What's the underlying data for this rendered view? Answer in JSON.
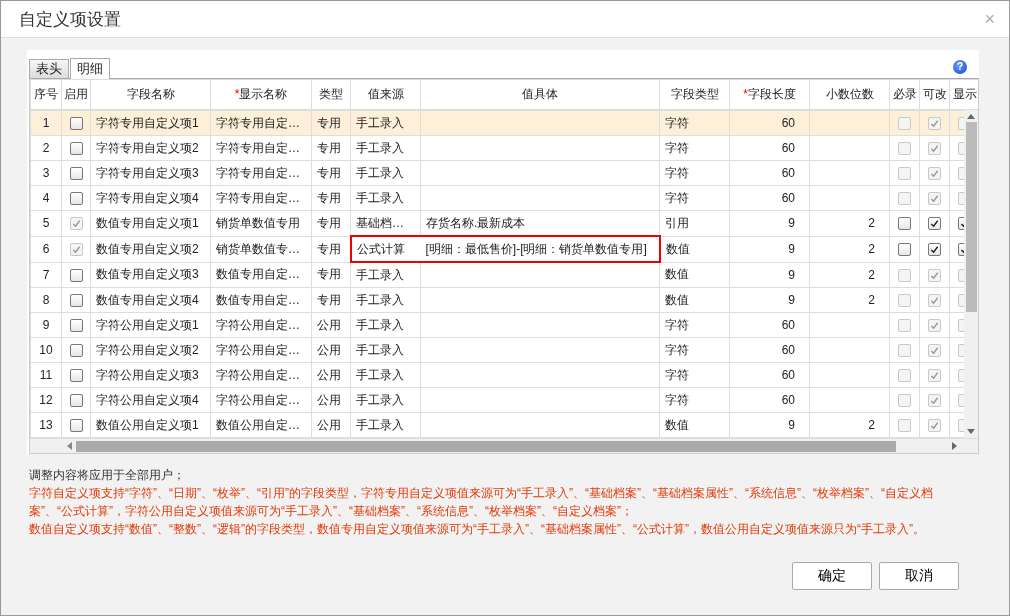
{
  "dialog": {
    "title": "自定义项设置",
    "close": "×"
  },
  "tabs": [
    {
      "label": "表头",
      "selected": false
    },
    {
      "label": "明细",
      "selected": true
    }
  ],
  "help": "?",
  "table": {
    "columns": [
      {
        "label": "序号"
      },
      {
        "label": "启用"
      },
      {
        "label": "字段名称"
      },
      {
        "label": "显示名称",
        "mark": "*"
      },
      {
        "label": "类型"
      },
      {
        "label": "值来源"
      },
      {
        "label": "值具体"
      },
      {
        "label": "字段类型"
      },
      {
        "label": "字段长度",
        "mark": "*"
      },
      {
        "label": "小数位数"
      },
      {
        "label": "必录"
      },
      {
        "label": "可改"
      },
      {
        "label": "显示"
      }
    ],
    "rows": [
      {
        "no": "1",
        "selected": true,
        "highlighted": false,
        "enabled": {
          "checked": false,
          "disabled": false
        },
        "name": "字符专用自定义项1",
        "display": "字符专用自定…",
        "scope": "专用",
        "source": "手工录入",
        "field_type": "字符",
        "length": "60",
        "required": {
          "checked": false,
          "disabled": true
        },
        "editable": {
          "checked": true,
          "disabled": true
        },
        "shown": {
          "checked": false,
          "disabled": true
        }
      },
      {
        "no": "2",
        "selected": false,
        "highlighted": false,
        "enabled": {
          "checked": false,
          "disabled": false
        },
        "name": "字符专用自定义项2",
        "display": "字符专用自定…",
        "scope": "专用",
        "source": "手工录入",
        "field_type": "字符",
        "length": "60",
        "required": {
          "checked": false,
          "disabled": true
        },
        "editable": {
          "checked": true,
          "disabled": true
        },
        "shown": {
          "checked": false,
          "disabled": true
        }
      },
      {
        "no": "3",
        "selected": false,
        "highlighted": false,
        "enabled": {
          "checked": false,
          "disabled": false
        },
        "name": "字符专用自定义项3",
        "display": "字符专用自定…",
        "scope": "专用",
        "source": "手工录入",
        "field_type": "字符",
        "length": "60",
        "required": {
          "checked": false,
          "disabled": true
        },
        "editable": {
          "checked": true,
          "disabled": true
        },
        "shown": {
          "checked": false,
          "disabled": true
        }
      },
      {
        "no": "4",
        "selected": false,
        "highlighted": false,
        "enabled": {
          "checked": false,
          "disabled": false
        },
        "name": "字符专用自定义项4",
        "display": "字符专用自定…",
        "scope": "专用",
        "source": "手工录入",
        "field_type": "字符",
        "length": "60",
        "required": {
          "checked": false,
          "disabled": true
        },
        "editable": {
          "checked": true,
          "disabled": true
        },
        "shown": {
          "checked": false,
          "disabled": true
        }
      },
      {
        "no": "5",
        "selected": false,
        "highlighted": false,
        "enabled": {
          "checked": true,
          "disabled": true
        },
        "name": "数值专用自定义项1",
        "display": "销货单数值专用",
        "scope": "专用",
        "source": "基础档…",
        "value": "存货名称.最新成本",
        "field_type": "引用",
        "length": "9",
        "decimals": "2",
        "required": {
          "checked": false,
          "disabled": false
        },
        "editable": {
          "checked": true,
          "disabled": false
        },
        "shown": {
          "checked": true,
          "disabled": false
        }
      },
      {
        "no": "6",
        "selected": false,
        "highlighted": true,
        "enabled": {
          "checked": true,
          "disabled": true
        },
        "name": "数值专用自定义项2",
        "display": "销货单数值专…",
        "scope": "专用",
        "source": "公式计算",
        "value": "[明细：最低售价]-[明细：销货单数值专用]",
        "field_type": "数值",
        "length": "9",
        "decimals": "2",
        "required": {
          "checked": false,
          "disabled": false
        },
        "editable": {
          "checked": true,
          "disabled": false
        },
        "shown": {
          "checked": true,
          "disabled": false
        }
      },
      {
        "no": "7",
        "selected": false,
        "highlighted": false,
        "enabled": {
          "checked": false,
          "disabled": false
        },
        "name": "数值专用自定义项3",
        "display": "数值专用自定…",
        "scope": "专用",
        "source": "手工录入",
        "field_type": "数值",
        "length": "9",
        "decimals": "2",
        "required": {
          "checked": false,
          "disabled": true
        },
        "editable": {
          "checked": true,
          "disabled": true
        },
        "shown": {
          "checked": false,
          "disabled": true
        }
      },
      {
        "no": "8",
        "selected": false,
        "highlighted": false,
        "enabled": {
          "checked": false,
          "disabled": false
        },
        "name": "数值专用自定义项4",
        "display": "数值专用自定…",
        "scope": "专用",
        "source": "手工录入",
        "field_type": "数值",
        "length": "9",
        "decimals": "2",
        "required": {
          "checked": false,
          "disabled": true
        },
        "editable": {
          "checked": true,
          "disabled": true
        },
        "shown": {
          "checked": false,
          "disabled": true
        }
      },
      {
        "no": "9",
        "selected": false,
        "highlighted": false,
        "enabled": {
          "checked": false,
          "disabled": false
        },
        "name": "字符公用自定义项1",
        "display": "字符公用自定…",
        "scope": "公用",
        "source": "手工录入",
        "field_type": "字符",
        "length": "60",
        "required": {
          "checked": false,
          "disabled": true
        },
        "editable": {
          "checked": true,
          "disabled": true
        },
        "shown": {
          "checked": false,
          "disabled": true
        }
      },
      {
        "no": "10",
        "selected": false,
        "highlighted": false,
        "enabled": {
          "checked": false,
          "disabled": false
        },
        "name": "字符公用自定义项2",
        "display": "字符公用自定…",
        "scope": "公用",
        "source": "手工录入",
        "field_type": "字符",
        "length": "60",
        "required": {
          "checked": false,
          "disabled": true
        },
        "editable": {
          "checked": true,
          "disabled": true
        },
        "shown": {
          "checked": false,
          "disabled": true
        }
      },
      {
        "no": "11",
        "selected": false,
        "highlighted": false,
        "enabled": {
          "checked": false,
          "disabled": false
        },
        "name": "字符公用自定义项3",
        "display": "字符公用自定…",
        "scope": "公用",
        "source": "手工录入",
        "field_type": "字符",
        "length": "60",
        "required": {
          "checked": false,
          "disabled": true
        },
        "editable": {
          "checked": true,
          "disabled": true
        },
        "shown": {
          "checked": false,
          "disabled": true
        }
      },
      {
        "no": "12",
        "selected": false,
        "highlighted": false,
        "enabled": {
          "checked": false,
          "disabled": false
        },
        "name": "字符公用自定义项4",
        "display": "字符公用自定…",
        "scope": "公用",
        "source": "手工录入",
        "field_type": "字符",
        "length": "60",
        "required": {
          "checked": false,
          "disabled": true
        },
        "editable": {
          "checked": true,
          "disabled": true
        },
        "shown": {
          "checked": false,
          "disabled": true
        }
      },
      {
        "no": "13",
        "selected": false,
        "highlighted": false,
        "enabled": {
          "checked": false,
          "disabled": false
        },
        "name": "数值公用自定义项1",
        "display": "数值公用自定…",
        "scope": "公用",
        "source": "手工录入",
        "field_type": "数值",
        "length": "9",
        "decimals": "2",
        "required": {
          "checked": false,
          "disabled": true
        },
        "editable": {
          "checked": true,
          "disabled": true
        },
        "shown": {
          "checked": false,
          "disabled": true
        }
      }
    ]
  },
  "notes": [
    {
      "kind": "info",
      "text": "调整内容将应用于全部用户；"
    },
    {
      "kind": "warning",
      "text": "字符自定义项支持“字符”、“日期”、“枚举”、“引用”的字段类型，字符专用自定义项值来源可为“手工录入”、“基础档案”、“基础档案属性”、“系统信息”、“枚举档案”、“自定义档案”、“公式计算”，字符公用自定义项值来源可为“手工录入”、“基础档案”、“系统信息”、“枚举档案”、“自定义档案”；"
    },
    {
      "kind": "warning",
      "text": "数值自定义项支持“数值”、“整数”、“逻辑”的字段类型，数值专用自定义项值来源可为“手工录入”、“基础档案属性”、“公式计算”，数值公用自定义项值来源只为“手工录入”。"
    }
  ],
  "buttons": [
    "确定",
    "取消"
  ]
}
